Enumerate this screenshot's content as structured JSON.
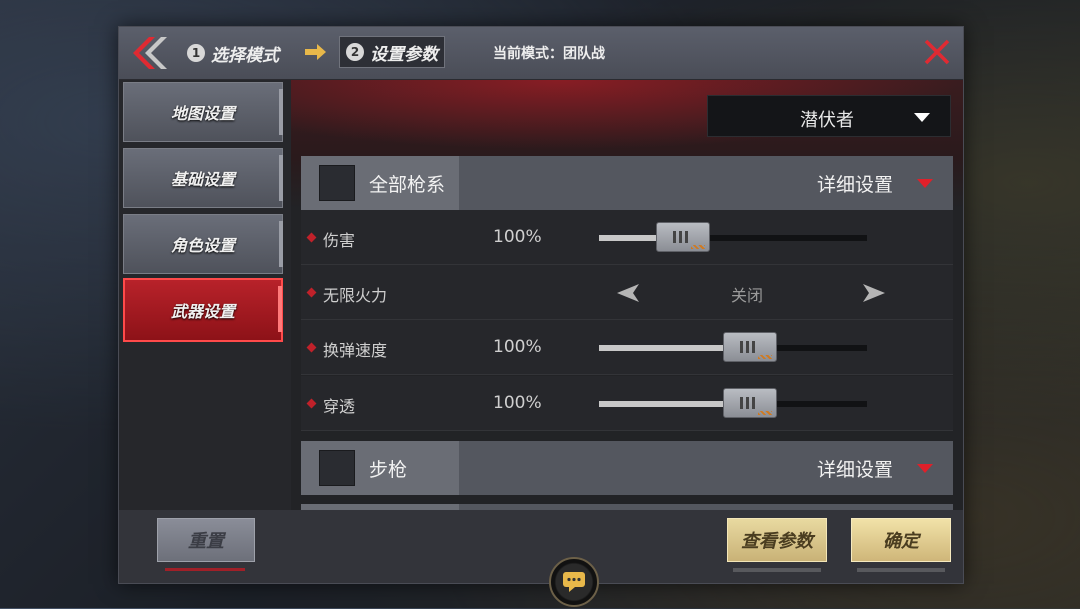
{
  "header": {
    "step1_num": "1",
    "step1_label": "选择模式",
    "step2_num": "2",
    "step2_label": "设置参数",
    "mode_label": "当前模式：团队战"
  },
  "sidebar": {
    "items": [
      {
        "label": "地图设置",
        "active": false
      },
      {
        "label": "基础设置",
        "active": false
      },
      {
        "label": "角色设置",
        "active": false
      },
      {
        "label": "武器设置",
        "active": true
      }
    ]
  },
  "role_dropdown": {
    "value": "潜伏者"
  },
  "sections": [
    {
      "title": "全部枪系",
      "detail_label": "详细设置",
      "rows": [
        {
          "label": "伤害",
          "value": "100%",
          "type": "slider",
          "level_pct": 25
        },
        {
          "label": "无限火力",
          "value": "关闭",
          "type": "toggle"
        },
        {
          "label": "换弹速度",
          "value": "100%",
          "type": "slider",
          "level_pct": 50
        },
        {
          "label": "穿透",
          "value": "100%",
          "type": "slider",
          "level_pct": 50
        }
      ]
    },
    {
      "title": "步枪",
      "detail_label": "详细设置"
    }
  ],
  "footer": {
    "reset_label": "重置",
    "view_params_label": "查看参数",
    "confirm_label": "确定"
  },
  "colors": {
    "accent_red": "#e0202a",
    "active_tab": "#b8222a",
    "gold_button": "#e8d9a0"
  },
  "icons": [
    "back-chevron-icon",
    "arrow-right-icon",
    "close-icon",
    "caret-down-icon",
    "arrow-left-icon",
    "chat-bubble-icon"
  ]
}
